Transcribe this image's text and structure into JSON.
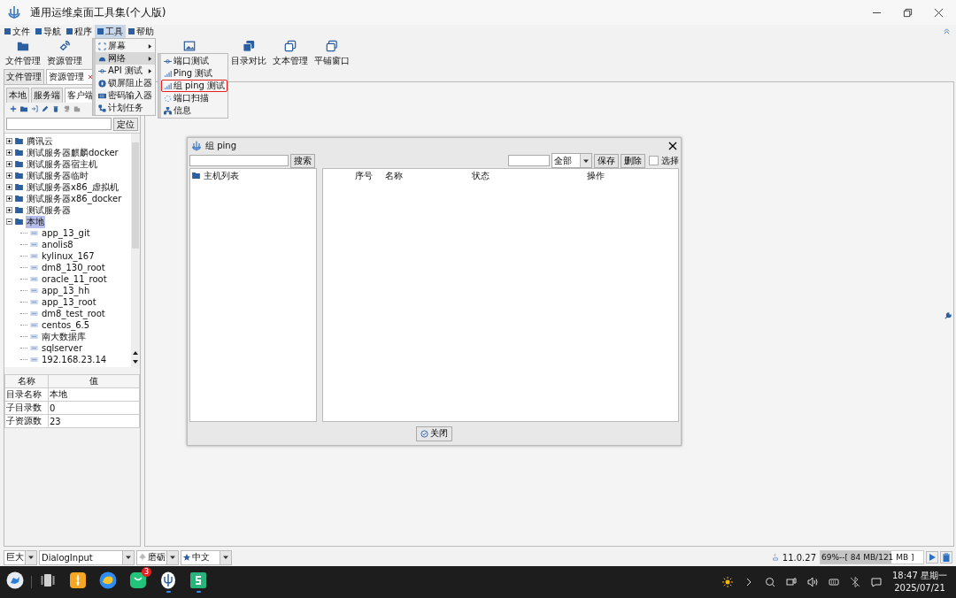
{
  "window": {
    "title": "通用运维桌面工具集(个人版)"
  },
  "menu_bar": [
    {
      "label": "文件",
      "selected": false
    },
    {
      "label": "导航",
      "selected": false
    },
    {
      "label": "程序",
      "selected": false
    },
    {
      "label": "工具",
      "selected": true
    },
    {
      "label": "帮助",
      "selected": false
    }
  ],
  "toolbar": [
    {
      "kind": "labeled",
      "label": "文件管理"
    },
    {
      "kind": "labeled",
      "label": "资源管理"
    },
    {
      "kind": "covered"
    },
    {
      "kind": "covered"
    },
    {
      "kind": "icon_only"
    },
    {
      "kind": "labeled",
      "label": "目录对比"
    },
    {
      "kind": "labeled",
      "label": "文本管理"
    },
    {
      "kind": "labeled",
      "label": "平铺窗口"
    }
  ],
  "tools_menu": [
    {
      "label": "屏幕",
      "submenu": true,
      "selected": false
    },
    {
      "label": "网络",
      "submenu": true,
      "selected": true
    },
    {
      "label": "API 测试",
      "submenu": true,
      "selected": false
    },
    {
      "label": "锁屏阻止器",
      "submenu": false,
      "selected": false
    },
    {
      "label": "密码输入器",
      "submenu": false,
      "selected": false
    },
    {
      "label": "计划任务",
      "submenu": false,
      "selected": false
    }
  ],
  "network_submenu": [
    {
      "label": "端口测试",
      "selected": false
    },
    {
      "label": "Ping 测试",
      "selected": false
    },
    {
      "label": "组 ping 测试",
      "selected": true
    },
    {
      "label": "端口扫描",
      "selected": false
    },
    {
      "label": "信息",
      "selected": false
    }
  ],
  "left_panel": {
    "tabs": [
      {
        "label": "文件管理",
        "closable": false,
        "selected": false
      },
      {
        "label": "资源管理",
        "closable": true,
        "selected": true
      }
    ],
    "sub_tabs": [
      {
        "label": "本地",
        "selected": false
      },
      {
        "label": "服务端",
        "selected": false
      },
      {
        "label": "客户端",
        "selected": true
      }
    ],
    "locate_button": "定位",
    "tree": [
      {
        "label": "腾讯云",
        "expanded": false,
        "selected": false
      },
      {
        "label": "测试服务器麒麟docker",
        "expanded": false,
        "selected": false
      },
      {
        "label": "测试服务器宿主机",
        "expanded": false,
        "selected": false
      },
      {
        "label": "测试服务器临时",
        "expanded": false,
        "selected": false
      },
      {
        "label": "测试服务器x86_虚拟机",
        "expanded": false,
        "selected": false
      },
      {
        "label": "测试服务器x86_docker",
        "expanded": false,
        "selected": false
      },
      {
        "label": "测试服务器",
        "expanded": false,
        "selected": false
      },
      {
        "label": "本地",
        "expanded": true,
        "selected": true,
        "children": [
          {
            "label": "app_13_git",
            "selected": false
          },
          {
            "label": "anolis8",
            "selected": false
          },
          {
            "label": "kylinux_167",
            "selected": false
          },
          {
            "label": "dm8_130_root",
            "selected": false
          },
          {
            "label": "oracle_11_root",
            "selected": false
          },
          {
            "label": "app_13_hh",
            "selected": false
          },
          {
            "label": "app_13_root",
            "selected": false
          },
          {
            "label": "dm8_test_root",
            "selected": false
          },
          {
            "label": "centos_6.5",
            "selected": false
          },
          {
            "label": "南大数据库",
            "selected": false
          },
          {
            "label": "sqlserver",
            "selected": false
          },
          {
            "label": "192.168.23.14",
            "selected": false
          }
        ]
      }
    ],
    "properties": {
      "columns": [
        "名称",
        "值"
      ],
      "rows": [
        [
          "目录名称",
          "本地"
        ],
        [
          "子目录数",
          "0"
        ],
        [
          "子资源数",
          "23"
        ]
      ]
    }
  },
  "dialog": {
    "title": "组 ping",
    "search_button": "搜索",
    "filter": "全部",
    "buttons": [
      "保存",
      "删除"
    ],
    "select": {
      "label": "选择",
      "checked": false
    },
    "tree": [
      {
        "label": "主机列表"
      }
    ],
    "columns": [
      "序号",
      "名称",
      "状态",
      "操作"
    ],
    "close_button": "关闭"
  },
  "status_bar": {
    "combos": [
      "巨大",
      "DialogInput",
      "磨砺",
      "中文"
    ],
    "java_version": "11.0.27",
    "memory": {
      "text": "69%--[ 84 MB/121 MB ]",
      "level": 0.69
    }
  },
  "taskbar": {
    "apps": [
      {
        "active": false
      },
      {
        "active": false
      },
      {
        "active": false
      },
      {
        "active": false
      },
      {
        "active": false,
        "badge": "3"
      },
      {
        "active": true
      },
      {
        "active": true
      }
    ],
    "clock": {
      "time": "18:47 星期一",
      "date": "2025/07/21"
    }
  }
}
